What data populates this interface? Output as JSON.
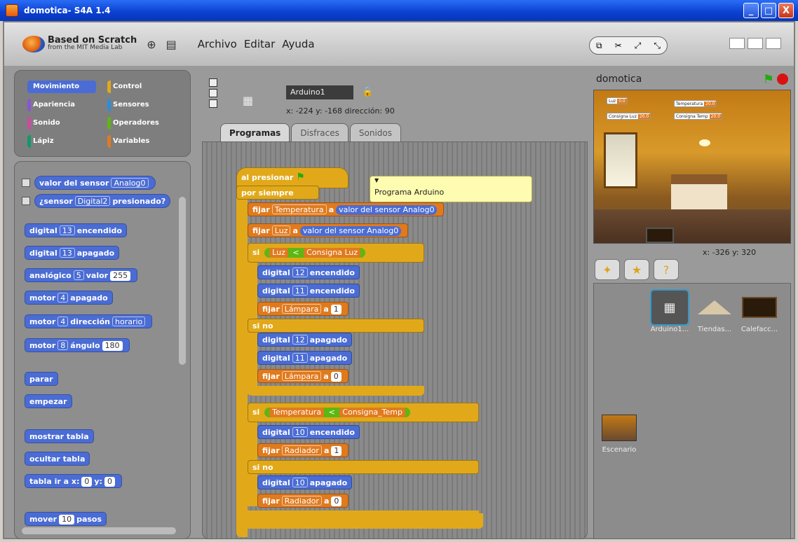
{
  "window": {
    "title": "domotica- S4A 1.4",
    "min": "_",
    "max": "□",
    "close": "X"
  },
  "logo": {
    "title": "Based on Scratch",
    "subtitle": "from the MIT Media Lab"
  },
  "menu": {
    "items": [
      "Archivo",
      "Editar",
      "Ayuda"
    ]
  },
  "categories": [
    {
      "label": "Movimiento",
      "color": "#4a6cd4"
    },
    {
      "label": "Control",
      "color": "#e1a91a"
    },
    {
      "label": "Apariencia",
      "color": "#8a55d7"
    },
    {
      "label": "Sensores",
      "color": "#2b8fd8"
    },
    {
      "label": "Sonido",
      "color": "#cf4aa0"
    },
    {
      "label": "Operadores",
      "color": "#5cb712"
    },
    {
      "label": "Lápiz",
      "color": "#0e9a6c"
    },
    {
      "label": "Variables",
      "color": "#e07a1e"
    }
  ],
  "palette": {
    "sensor_value": {
      "text": "valor del sensor",
      "option": "Analog0"
    },
    "sensor_pressed": {
      "text": "¿sensor",
      "option": "Digital2",
      "suffix": "presionado?"
    },
    "digital_on": {
      "pre": "digital",
      "pin": "13",
      "post": "encendido"
    },
    "digital_off": {
      "pre": "digital",
      "pin": "13",
      "post": "apagado"
    },
    "analog": {
      "pre": "analógico",
      "pin": "5",
      "mid": "valor",
      "val": "255"
    },
    "motor_off": {
      "pre": "motor",
      "pin": "4",
      "post": "apagado"
    },
    "motor_dir": {
      "pre": "motor",
      "pin": "4",
      "mid": "dirección",
      "opt": "horario"
    },
    "motor_angle": {
      "pre": "motor",
      "pin": "8",
      "mid": "ángulo",
      "val": "180"
    },
    "stop": "parar",
    "start": "empezar",
    "show_board": "mostrar tabla",
    "hide_board": "ocultar tabla",
    "board_at": {
      "pre": "tabla ir a x:",
      "x": "0",
      "mid": "y:",
      "y": "0"
    },
    "move": {
      "pre": "mover",
      "val": "10",
      "post": "pasos"
    }
  },
  "sprite": {
    "name": "Arduino1",
    "coords": "x: -224 y: -168 dirección: 90"
  },
  "tabs": [
    "Programas",
    "Disfraces",
    "Sonidos"
  ],
  "script": {
    "hat": "al presionar",
    "forever": "por siempre",
    "set_temp": {
      "pre": "fijar",
      "var": "Temperatura",
      "mid": "a",
      "sensor": "valor del sensor",
      "opt": "Analog0"
    },
    "set_luz": {
      "pre": "fijar",
      "var": "Luz",
      "mid": "a",
      "sensor": "valor del sensor",
      "opt": "Analog0"
    },
    "if1": {
      "pre": "si",
      "left": "Luz",
      "op": "<",
      "right": "Consigna Luz"
    },
    "d12_on": {
      "pre": "digital",
      "pin": "12",
      "post": "encendido"
    },
    "d11_on": {
      "pre": "digital",
      "pin": "11",
      "post": "encendido"
    },
    "set_lamp1": {
      "pre": "fijar",
      "var": "Lámpara",
      "mid": "a",
      "val": "1"
    },
    "else1": "si no",
    "d12_off": {
      "pre": "digital",
      "pin": "12",
      "post": "apagado"
    },
    "d11_off": {
      "pre": "digital",
      "pin": "11",
      "post": "apagado"
    },
    "set_lamp0": {
      "pre": "fijar",
      "var": "Lámpara",
      "mid": "a",
      "val": "0"
    },
    "if2": {
      "pre": "si",
      "left": "Temperatura",
      "op": "<",
      "right": "Consigna_Temp"
    },
    "d10_on": {
      "pre": "digital",
      "pin": "10",
      "post": "encendido"
    },
    "set_rad1": {
      "pre": "fijar",
      "var": "Radiador",
      "mid": "a",
      "val": "1"
    },
    "else2": "si no",
    "d10_off": {
      "pre": "digital",
      "pin": "10",
      "post": "apagado"
    },
    "set_rad0": {
      "pre": "fijar",
      "var": "Radiador",
      "mid": "a",
      "val": "0"
    },
    "comment": "Programa Arduino"
  },
  "stage": {
    "title": "domotica",
    "coords": "x: -326 y: 320",
    "monitors": [
      {
        "label": "Luz",
        "value": "0.0"
      },
      {
        "label": "Temperatura",
        "value": "20.0"
      },
      {
        "label": "Consigna Luz",
        "value": "20.0"
      },
      {
        "label": "Consigna Temp",
        "value": "20.0"
      }
    ]
  },
  "sprites": [
    {
      "name": "Arduino1..."
    },
    {
      "name": "Tiendas..."
    },
    {
      "name": "Calefacc..."
    }
  ],
  "stage_item": "Escenario"
}
